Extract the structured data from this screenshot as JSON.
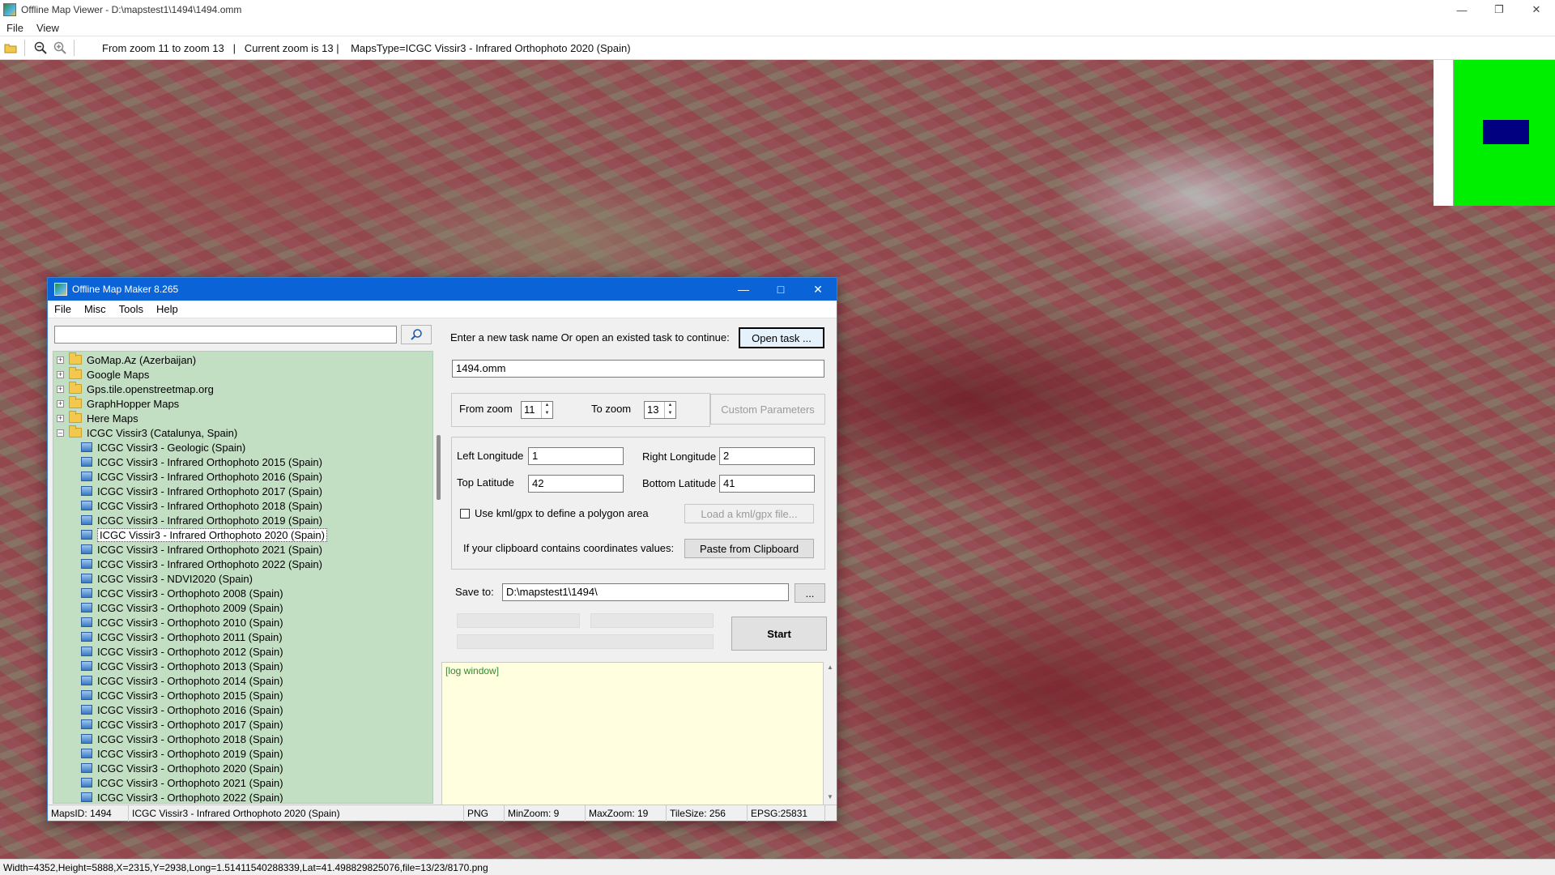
{
  "viewer": {
    "title": "Offline Map Viewer - D:\\mapstest1\\1494\\1494.omm",
    "menu": [
      "File",
      "View"
    ],
    "toolbar_info": "From zoom 11 to zoom 13   |   Current zoom is 13 |    MapsType=ICGC Vissir3 - Infrared Orthophoto 2020 (Spain)",
    "status": "Width=4352,Height=5888,X=2315,Y=2938,Long=1.51411540288339,Lat=41.498829825076,file=13/23/8170.png",
    "colors": {
      "minimap_bg": "#00ee00",
      "minimap_viewport": "#000080"
    }
  },
  "maker": {
    "title": "Offline Map Maker 8.265",
    "menu": [
      "File",
      "Misc",
      "Tools",
      "Help"
    ],
    "search": {
      "value": "",
      "icon": "search-icon"
    },
    "tree": {
      "folders": [
        {
          "label": "GoMap.Az (Azerbaijan)",
          "expanded": false
        },
        {
          "label": "Google Maps",
          "expanded": false
        },
        {
          "label": "Gps.tile.openstreetmap.org",
          "expanded": false
        },
        {
          "label": "GraphHopper Maps",
          "expanded": false
        },
        {
          "label": "Here Maps",
          "expanded": false
        },
        {
          "label": "ICGC Vissir3 (Catalunya, Spain)",
          "expanded": true
        }
      ],
      "children": [
        "ICGC Vissir3 - Geologic (Spain)",
        "ICGC Vissir3 - Infrared Orthophoto 2015 (Spain)",
        "ICGC Vissir3 - Infrared Orthophoto 2016 (Spain)",
        "ICGC Vissir3 - Infrared Orthophoto 2017 (Spain)",
        "ICGC Vissir3 - Infrared Orthophoto 2018 (Spain)",
        "ICGC Vissir3 - Infrared Orthophoto 2019 (Spain)",
        "ICGC Vissir3 - Infrared Orthophoto 2020 (Spain)",
        "ICGC Vissir3 - Infrared Orthophoto 2021 (Spain)",
        "ICGC Vissir3 - Infrared Orthophoto 2022 (Spain)",
        "ICGC Vissir3 - NDVI2020 (Spain)",
        "ICGC Vissir3 - Orthophoto 2008 (Spain)",
        "ICGC Vissir3 - Orthophoto 2009 (Spain)",
        "ICGC Vissir3 - Orthophoto 2010 (Spain)",
        "ICGC Vissir3 - Orthophoto 2011 (Spain)",
        "ICGC Vissir3 - Orthophoto 2012 (Spain)",
        "ICGC Vissir3 - Orthophoto 2013 (Spain)",
        "ICGC Vissir3 - Orthophoto 2014 (Spain)",
        "ICGC Vissir3 - Orthophoto 2015 (Spain)",
        "ICGC Vissir3 - Orthophoto 2016 (Spain)",
        "ICGC Vissir3 - Orthophoto 2017 (Spain)",
        "ICGC Vissir3 - Orthophoto 2018 (Spain)",
        "ICGC Vissir3 - Orthophoto 2019 (Spain)",
        "ICGC Vissir3 - Orthophoto 2020 (Spain)",
        "ICGC Vissir3 - Orthophoto 2021 (Spain)",
        "ICGC Vissir3 - Orthophoto 2022 (Spain)"
      ],
      "selected": "ICGC Vissir3 - Infrared Orthophoto 2020 (Spain)"
    },
    "task": {
      "prompt": "Enter a new task name Or open an existed task to continue:",
      "open_button": "Open task ...",
      "name_value": "1494.omm"
    },
    "zoom": {
      "from_label": "From zoom",
      "from_value": "11",
      "to_label": "To zoom",
      "to_value": "13",
      "custom_button": "Custom Parameters"
    },
    "coords": {
      "left_lon_label": "Left Longitude",
      "left_lon_value": "1",
      "right_lon_label": "Right Longitude",
      "right_lon_value": "2",
      "top_lat_label": "Top Latitude",
      "top_lat_value": "42",
      "bottom_lat_label": "Bottom Latitude",
      "bottom_lat_value": "41",
      "kml_label": "Use kml/gpx to define a polygon area",
      "kml_button": "Load a kml/gpx file...",
      "clipboard_label": "If your clipboard contains coordinates values:",
      "clipboard_button": "Paste from Clipboard"
    },
    "save": {
      "label": "Save to:",
      "value": "D:\\mapstest1\\1494\\",
      "browse_button": "...",
      "start_button": "Start"
    },
    "log_text": "[log window]",
    "status": {
      "maps_id": "MapsID: 1494",
      "map_name": "ICGC Vissir3 - Infrared Orthophoto 2020 (Spain)",
      "format": "PNG",
      "min_zoom": "MinZoom: 9",
      "max_zoom": "MaxZoom: 19",
      "tile_size": "TileSize: 256",
      "epsg": "EPSG:25831"
    }
  }
}
